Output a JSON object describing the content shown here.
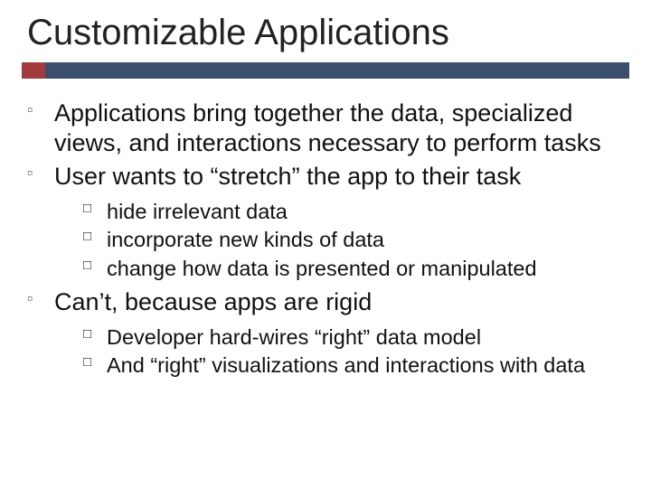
{
  "title": "Customizable Applications",
  "bullets": {
    "b1": "Applications bring together the data, specialized views, and interactions necessary to perform tasks",
    "b2": "User wants to “stretch” the app to their task",
    "b2_subs": {
      "s1": "hide irrelevant data",
      "s2": "incorporate new kinds of data",
      "s3": "change how data is presented or manipulated"
    },
    "b3": "Can’t, because apps are rigid",
    "b3_subs": {
      "s1": "Developer hard-wires “right” data model",
      "s2": "And “right” visualizations and interactions with data"
    }
  }
}
